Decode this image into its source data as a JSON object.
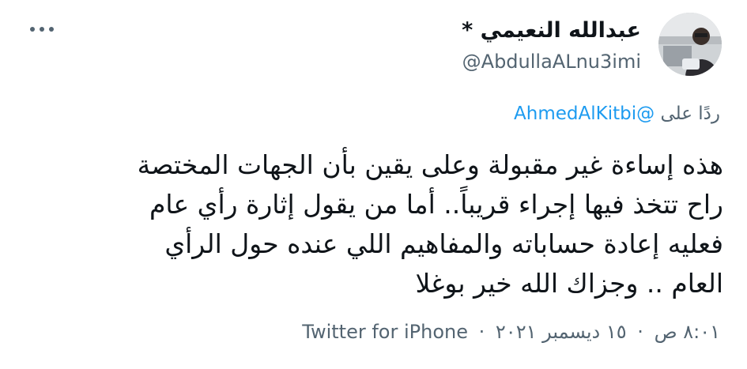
{
  "author": {
    "display_name": "عبدالله النعيمي *",
    "handle": "@AbdullaALnu3imi"
  },
  "reply": {
    "prefix": "ردًا على",
    "mention": "@AhmedAlKitbi"
  },
  "tweet": {
    "text": "هذه إساءة غير مقبولة وعلى يقين بأن الجهات المختصة\nراح تتخذ فيها إجراء قريباً.. أما من يقول إثارة رأي عام\nفعليه إعادة حساباته والمفاهيم اللي عنده حول الرأي\nالعام .. وجزاك الله خير بوغلا"
  },
  "meta": {
    "time": "٨:٠١ ص",
    "date": "١٥ ديسمبر ٢٠٢١",
    "separator": "·",
    "source": "Twitter for iPhone"
  },
  "icons": {
    "more": "more-horizontal-icon",
    "avatar": "avatar"
  },
  "colors": {
    "link": "#1d9bf0",
    "secondary_text": "#536471",
    "primary_text": "#0f1419"
  }
}
